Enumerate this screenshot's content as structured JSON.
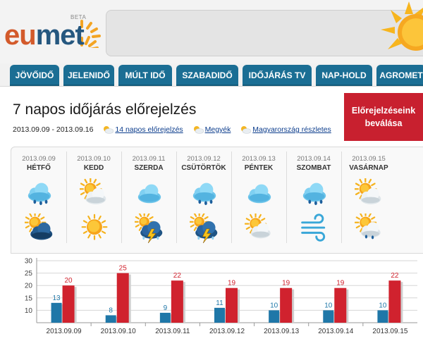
{
  "logo": {
    "eu": "eu",
    "met": "met",
    "beta": "BETA"
  },
  "nav": {
    "tabs": [
      {
        "label": "JÖVŐIDŐ"
      },
      {
        "label": "JELENIDŐ"
      },
      {
        "label": "MÚLT IDŐ"
      },
      {
        "label": "SZABADIDŐ"
      },
      {
        "label": "IDŐJÁRÁS TV"
      },
      {
        "label": "NAP-HOLD"
      },
      {
        "label": "AGROMET"
      }
    ]
  },
  "page": {
    "title": "7 napos időjárás előrejelzés",
    "date_range": "2013.09.09 - 2013.09.16",
    "links": [
      {
        "label": "14 napos előrejelzés"
      },
      {
        "label": "Megyék"
      },
      {
        "label": "Magyarország részletes"
      }
    ],
    "cta_line1": "Előrejelzéseink",
    "cta_line2": "beválása"
  },
  "days": [
    {
      "date": "2013.09.09",
      "name": "HÉTFŐ",
      "icon_day": "rain-cloud-icon",
      "icon_night": "sun-dark-cloud-icon"
    },
    {
      "date": "2013.09.10",
      "name": "KEDD",
      "icon_day": "sun-cloud-icon",
      "icon_night": "sun-icon"
    },
    {
      "date": "2013.09.11",
      "name": "SZERDA",
      "icon_day": "cloud-icon",
      "icon_night": "thunderstorm-sun-icon"
    },
    {
      "date": "2013.09.12",
      "name": "CSÜTÖRTÖK",
      "icon_day": "rain-cloud-icon",
      "icon_night": "thunderstorm-sun-icon"
    },
    {
      "date": "2013.09.13",
      "name": "PÉNTEK",
      "icon_day": "cloud-icon",
      "icon_night": "sun-cloud-icon"
    },
    {
      "date": "2013.09.14",
      "name": "SZOMBAT",
      "icon_day": "rain-cloud-icon",
      "icon_night": "wind-icon"
    },
    {
      "date": "2013.09.15",
      "name": "VASÁRNAP",
      "icon_day": "sun-cloud-icon",
      "icon_night": "sun-rain-cloud-icon"
    }
  ],
  "chart_data": {
    "type": "bar",
    "categories": [
      "2013.09.09",
      "2013.09.10",
      "2013.09.11",
      "2013.09.12",
      "2013.09.13",
      "2013.09.14",
      "2013.09.15"
    ],
    "series": [
      {
        "values": [
          13,
          8,
          9,
          11,
          10,
          10,
          10
        ],
        "color": "#1f77a8"
      },
      {
        "values": [
          20,
          25,
          22,
          19,
          19,
          19,
          22
        ],
        "color": "#d0222e"
      }
    ],
    "yticks": [
      10,
      15,
      20,
      25,
      30
    ],
    "ylim": [
      5,
      30
    ],
    "grid": true
  },
  "colors": {
    "nav_tab": "#1b6e94",
    "cta": "#c8202f",
    "min_bar": "#1f77a8",
    "max_bar": "#d0222e"
  }
}
